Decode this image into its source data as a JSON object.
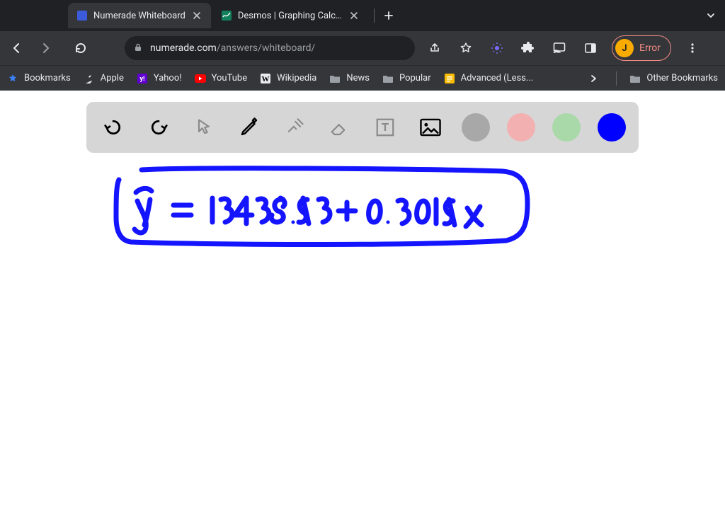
{
  "tabs": [
    {
      "title": "Numerade Whiteboard",
      "active": true
    },
    {
      "title": "Desmos | Graphing Calculato",
      "active": false
    }
  ],
  "nav": {
    "back_enabled": true,
    "forward_enabled": false,
    "reload_enabled": true
  },
  "url": {
    "host": "numerade.com",
    "path": "/answers/whiteboard/"
  },
  "profile": {
    "avatar_letter": "J",
    "error_label": "Error"
  },
  "bookmarks": [
    {
      "icon": "star",
      "label": "Bookmarks"
    },
    {
      "icon": "apple",
      "label": "Apple"
    },
    {
      "icon": "yahoo",
      "label": "Yahoo!"
    },
    {
      "icon": "youtube",
      "label": "YouTube"
    },
    {
      "icon": "wikipedia",
      "label": "Wikipedia"
    },
    {
      "icon": "folder",
      "label": "News"
    },
    {
      "icon": "folder",
      "label": "Popular"
    },
    {
      "icon": "gdoc",
      "label": "Advanced (Less..."
    }
  ],
  "other_bookmarks_label": "Other Bookmarks",
  "whiteboard": {
    "tools": [
      "undo",
      "redo",
      "pointer",
      "pen",
      "settings",
      "eraser",
      "text",
      "image"
    ],
    "colors": [
      "gray",
      "pink",
      "green",
      "blue"
    ],
    "selected_color": "blue",
    "handwriting_text": "ŷ = 13438.93 + 0.3019 x"
  }
}
